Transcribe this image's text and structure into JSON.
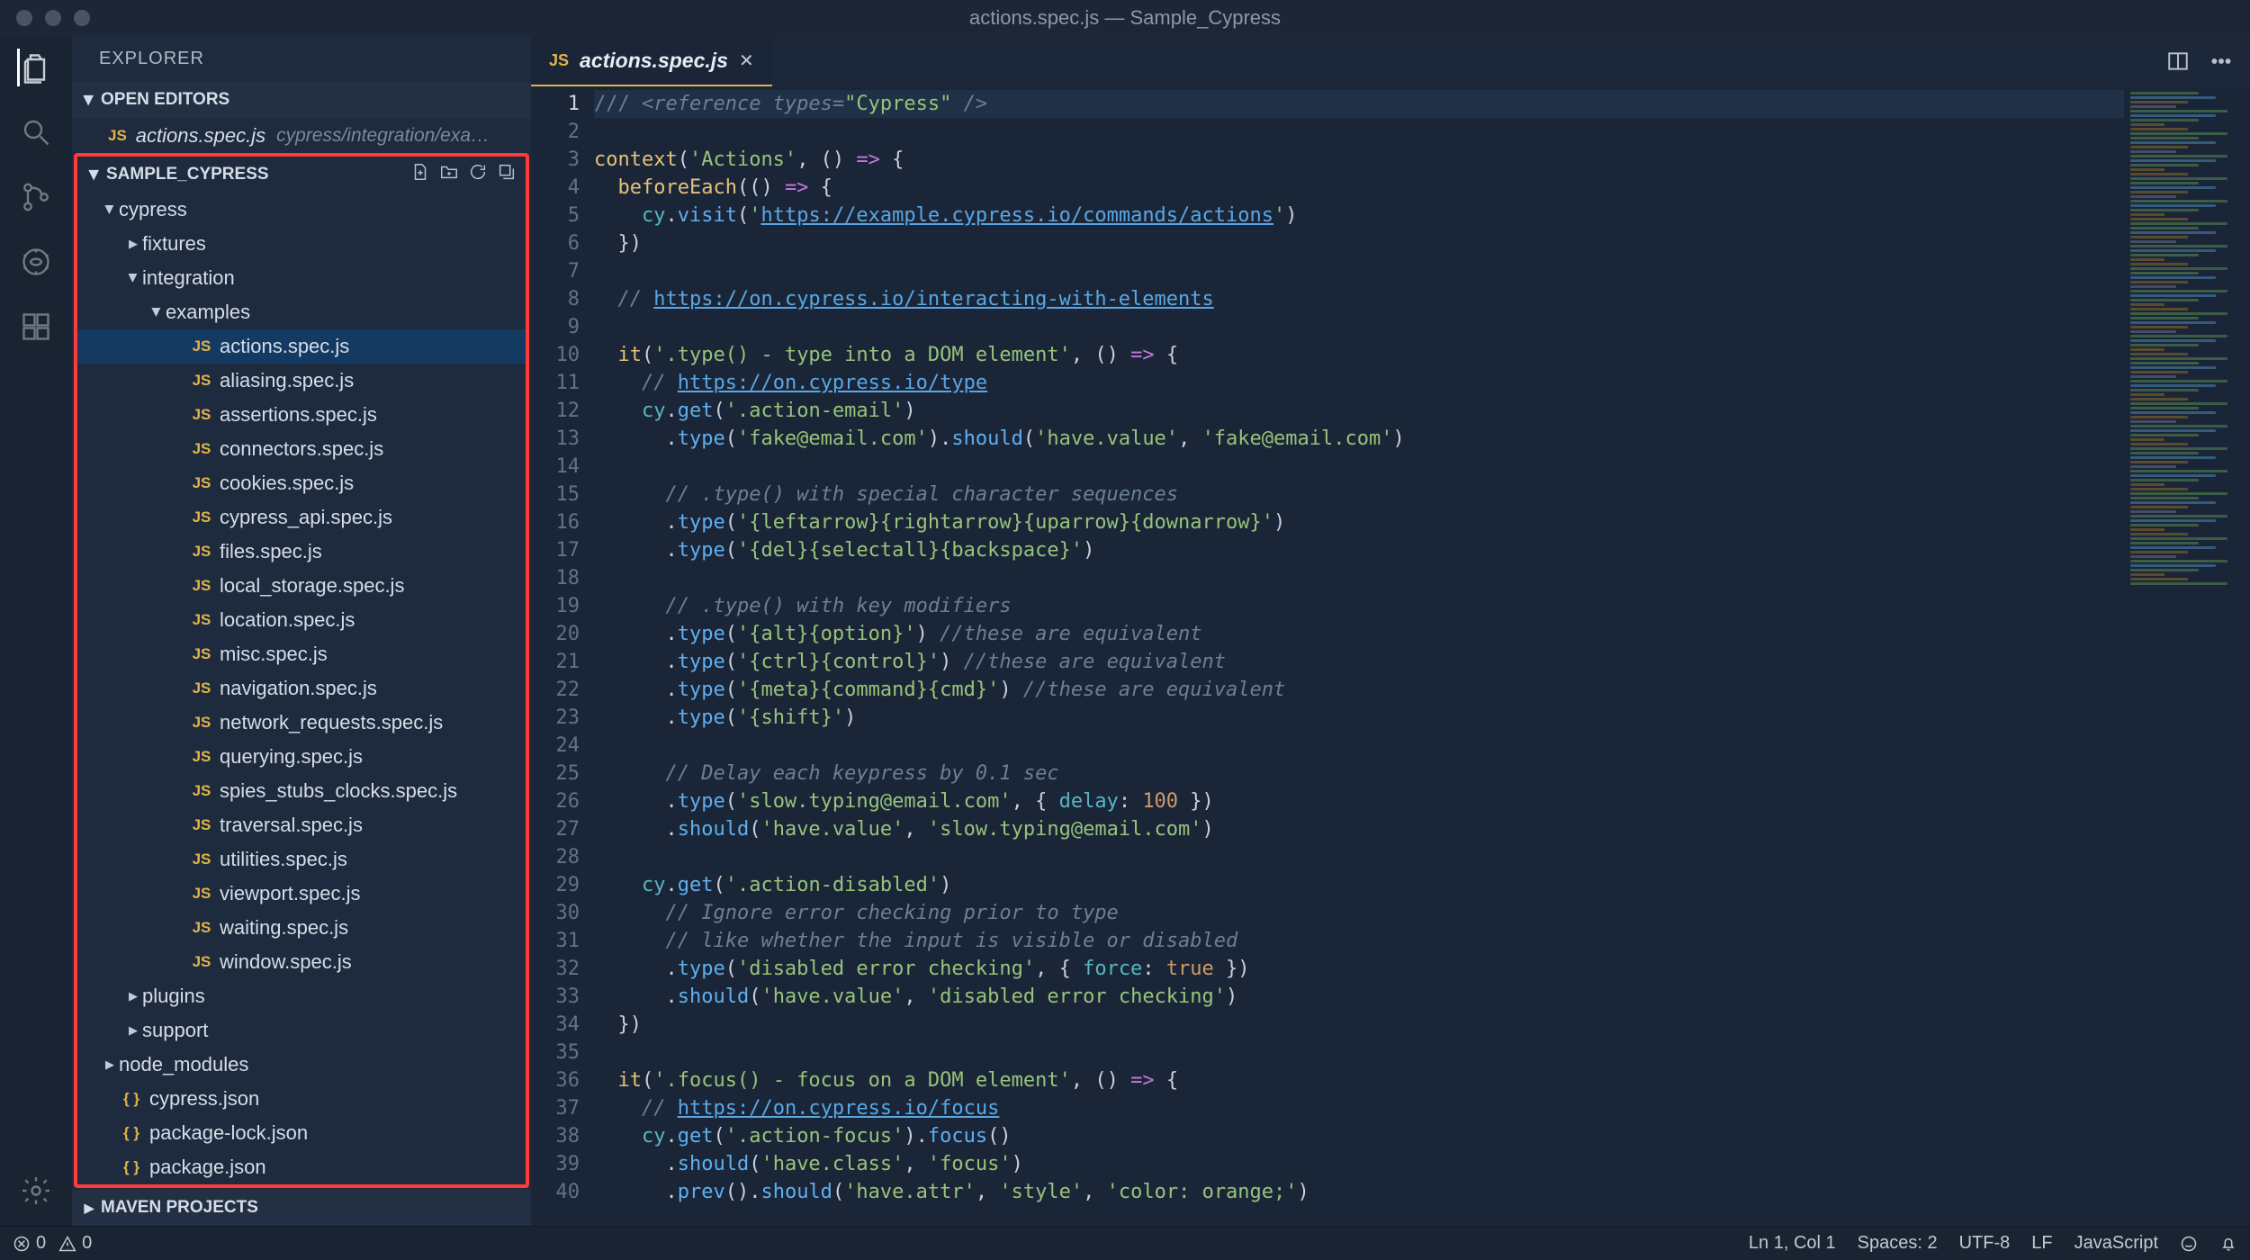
{
  "title": "actions.spec.js — Sample_Cypress",
  "sidebar": {
    "header": "EXPLORER",
    "sections": {
      "open_editors": {
        "label": "OPEN EDITORS",
        "items": [
          {
            "name": "actions.spec.js",
            "path": "cypress/integration/exa…",
            "icon": "JS"
          }
        ]
      },
      "project": {
        "label": "SAMPLE_CYPRESS",
        "tree": [
          {
            "label": "cypress",
            "type": "folder",
            "expanded": true,
            "depth": 0
          },
          {
            "label": "fixtures",
            "type": "folder",
            "expanded": false,
            "depth": 1
          },
          {
            "label": "integration",
            "type": "folder",
            "expanded": true,
            "depth": 1
          },
          {
            "label": "examples",
            "type": "folder",
            "expanded": true,
            "depth": 2
          },
          {
            "label": "actions.spec.js",
            "type": "js",
            "depth": 3,
            "selected": true
          },
          {
            "label": "aliasing.spec.js",
            "type": "js",
            "depth": 3
          },
          {
            "label": "assertions.spec.js",
            "type": "js",
            "depth": 3
          },
          {
            "label": "connectors.spec.js",
            "type": "js",
            "depth": 3
          },
          {
            "label": "cookies.spec.js",
            "type": "js",
            "depth": 3
          },
          {
            "label": "cypress_api.spec.js",
            "type": "js",
            "depth": 3
          },
          {
            "label": "files.spec.js",
            "type": "js",
            "depth": 3
          },
          {
            "label": "local_storage.spec.js",
            "type": "js",
            "depth": 3
          },
          {
            "label": "location.spec.js",
            "type": "js",
            "depth": 3
          },
          {
            "label": "misc.spec.js",
            "type": "js",
            "depth": 3
          },
          {
            "label": "navigation.spec.js",
            "type": "js",
            "depth": 3
          },
          {
            "label": "network_requests.spec.js",
            "type": "js",
            "depth": 3
          },
          {
            "label": "querying.spec.js",
            "type": "js",
            "depth": 3
          },
          {
            "label": "spies_stubs_clocks.spec.js",
            "type": "js",
            "depth": 3
          },
          {
            "label": "traversal.spec.js",
            "type": "js",
            "depth": 3
          },
          {
            "label": "utilities.spec.js",
            "type": "js",
            "depth": 3
          },
          {
            "label": "viewport.spec.js",
            "type": "js",
            "depth": 3
          },
          {
            "label": "waiting.spec.js",
            "type": "js",
            "depth": 3
          },
          {
            "label": "window.spec.js",
            "type": "js",
            "depth": 3
          },
          {
            "label": "plugins",
            "type": "folder",
            "expanded": false,
            "depth": 1
          },
          {
            "label": "support",
            "type": "folder",
            "expanded": false,
            "depth": 1
          },
          {
            "label": "node_modules",
            "type": "folder",
            "expanded": false,
            "depth": 0
          },
          {
            "label": "cypress.json",
            "type": "json",
            "depth": 0
          },
          {
            "label": "package-lock.json",
            "type": "json",
            "depth": 0
          },
          {
            "label": "package.json",
            "type": "json",
            "depth": 0
          }
        ]
      },
      "maven": {
        "label": "MAVEN PROJECTS"
      }
    }
  },
  "tabs": [
    {
      "name": "actions.spec.js",
      "icon": "JS",
      "active": true
    }
  ],
  "code": {
    "lines": [
      {
        "n": 1,
        "hl": true,
        "tokens": [
          [
            "c-comment",
            "/// "
          ],
          [
            "c-tag",
            "<reference "
          ],
          [
            "c-commentit",
            "types"
          ],
          [
            "c-tag",
            "="
          ],
          [
            "c-str",
            "\"Cypress\""
          ],
          [
            "c-tag",
            " />"
          ]
        ]
      },
      {
        "n": 2,
        "tokens": []
      },
      {
        "n": 3,
        "tokens": [
          [
            "c-fn",
            "context"
          ],
          [
            "c-plain",
            "("
          ],
          [
            "c-str",
            "'Actions'"
          ],
          [
            "c-plain",
            ", () "
          ],
          [
            "c-arrow",
            "=>"
          ],
          [
            "c-plain",
            " {"
          ]
        ]
      },
      {
        "n": 4,
        "tokens": [
          [
            "c-plain",
            "  "
          ],
          [
            "c-fn",
            "beforeEach"
          ],
          [
            "c-plain",
            "(() "
          ],
          [
            "c-arrow",
            "=>"
          ],
          [
            "c-plain",
            " {"
          ]
        ]
      },
      {
        "n": 5,
        "tokens": [
          [
            "c-plain",
            "    "
          ],
          [
            "c-this",
            "cy"
          ],
          [
            "c-plain",
            "."
          ],
          [
            "c-call",
            "visit"
          ],
          [
            "c-plain",
            "("
          ],
          [
            "c-str",
            "'"
          ],
          [
            "c-url",
            "https://example.cypress.io/commands/actions"
          ],
          [
            "c-str",
            "'"
          ],
          [
            "c-plain",
            ")"
          ]
        ]
      },
      {
        "n": 6,
        "tokens": [
          [
            "c-plain",
            "  })"
          ]
        ]
      },
      {
        "n": 7,
        "tokens": []
      },
      {
        "n": 8,
        "tokens": [
          [
            "c-plain",
            "  "
          ],
          [
            "c-commentit",
            "// "
          ],
          [
            "c-url",
            "https://on.cypress.io/interacting-with-elements"
          ]
        ]
      },
      {
        "n": 9,
        "tokens": []
      },
      {
        "n": 10,
        "tokens": [
          [
            "c-plain",
            "  "
          ],
          [
            "c-fn",
            "it"
          ],
          [
            "c-plain",
            "("
          ],
          [
            "c-str",
            "'.type() - type into a DOM element'"
          ],
          [
            "c-plain",
            ", () "
          ],
          [
            "c-arrow",
            "=>"
          ],
          [
            "c-plain",
            " {"
          ]
        ]
      },
      {
        "n": 11,
        "tokens": [
          [
            "c-plain",
            "    "
          ],
          [
            "c-commentit",
            "// "
          ],
          [
            "c-url",
            "https://on.cypress.io/type"
          ]
        ]
      },
      {
        "n": 12,
        "tokens": [
          [
            "c-plain",
            "    "
          ],
          [
            "c-this",
            "cy"
          ],
          [
            "c-plain",
            "."
          ],
          [
            "c-call",
            "get"
          ],
          [
            "c-plain",
            "("
          ],
          [
            "c-str",
            "'.action-email'"
          ],
          [
            "c-plain",
            ")"
          ]
        ]
      },
      {
        "n": 13,
        "tokens": [
          [
            "c-plain",
            "      ."
          ],
          [
            "c-call",
            "type"
          ],
          [
            "c-plain",
            "("
          ],
          [
            "c-str",
            "'fake@email.com'"
          ],
          [
            "c-plain",
            ")."
          ],
          [
            "c-call",
            "should"
          ],
          [
            "c-plain",
            "("
          ],
          [
            "c-str",
            "'have.value'"
          ],
          [
            "c-plain",
            ", "
          ],
          [
            "c-str",
            "'fake@email.com'"
          ],
          [
            "c-plain",
            ")"
          ]
        ]
      },
      {
        "n": 14,
        "tokens": []
      },
      {
        "n": 15,
        "tokens": [
          [
            "c-plain",
            "      "
          ],
          [
            "c-commentit",
            "// .type() with special character sequences"
          ]
        ]
      },
      {
        "n": 16,
        "tokens": [
          [
            "c-plain",
            "      ."
          ],
          [
            "c-call",
            "type"
          ],
          [
            "c-plain",
            "("
          ],
          [
            "c-str",
            "'{leftarrow}{rightarrow}{uparrow}{downarrow}'"
          ],
          [
            "c-plain",
            ")"
          ]
        ]
      },
      {
        "n": 17,
        "tokens": [
          [
            "c-plain",
            "      ."
          ],
          [
            "c-call",
            "type"
          ],
          [
            "c-plain",
            "("
          ],
          [
            "c-str",
            "'{del}{selectall}{backspace}'"
          ],
          [
            "c-plain",
            ")"
          ]
        ]
      },
      {
        "n": 18,
        "tokens": []
      },
      {
        "n": 19,
        "tokens": [
          [
            "c-plain",
            "      "
          ],
          [
            "c-commentit",
            "// .type() with key modifiers"
          ]
        ]
      },
      {
        "n": 20,
        "tokens": [
          [
            "c-plain",
            "      ."
          ],
          [
            "c-call",
            "type"
          ],
          [
            "c-plain",
            "("
          ],
          [
            "c-str",
            "'{alt}{option}'"
          ],
          [
            "c-plain",
            ") "
          ],
          [
            "c-commentit",
            "//these are equivalent"
          ]
        ]
      },
      {
        "n": 21,
        "tokens": [
          [
            "c-plain",
            "      ."
          ],
          [
            "c-call",
            "type"
          ],
          [
            "c-plain",
            "("
          ],
          [
            "c-str",
            "'{ctrl}{control}'"
          ],
          [
            "c-plain",
            ") "
          ],
          [
            "c-commentit",
            "//these are equivalent"
          ]
        ]
      },
      {
        "n": 22,
        "tokens": [
          [
            "c-plain",
            "      ."
          ],
          [
            "c-call",
            "type"
          ],
          [
            "c-plain",
            "("
          ],
          [
            "c-str",
            "'{meta}{command}{cmd}'"
          ],
          [
            "c-plain",
            ") "
          ],
          [
            "c-commentit",
            "//these are equivalent"
          ]
        ]
      },
      {
        "n": 23,
        "tokens": [
          [
            "c-plain",
            "      ."
          ],
          [
            "c-call",
            "type"
          ],
          [
            "c-plain",
            "("
          ],
          [
            "c-str",
            "'{shift}'"
          ],
          [
            "c-plain",
            ")"
          ]
        ]
      },
      {
        "n": 24,
        "tokens": []
      },
      {
        "n": 25,
        "tokens": [
          [
            "c-plain",
            "      "
          ],
          [
            "c-commentit",
            "// Delay each keypress by 0.1 sec"
          ]
        ]
      },
      {
        "n": 26,
        "tokens": [
          [
            "c-plain",
            "      ."
          ],
          [
            "c-call",
            "type"
          ],
          [
            "c-plain",
            "("
          ],
          [
            "c-str",
            "'slow.typing@email.com'"
          ],
          [
            "c-plain",
            ", { "
          ],
          [
            "c-prop",
            "delay"
          ],
          [
            "c-plain",
            ": "
          ],
          [
            "c-num",
            "100"
          ],
          [
            "c-plain",
            " })"
          ]
        ]
      },
      {
        "n": 27,
        "tokens": [
          [
            "c-plain",
            "      ."
          ],
          [
            "c-call",
            "should"
          ],
          [
            "c-plain",
            "("
          ],
          [
            "c-str",
            "'have.value'"
          ],
          [
            "c-plain",
            ", "
          ],
          [
            "c-str",
            "'slow.typing@email.com'"
          ],
          [
            "c-plain",
            ")"
          ]
        ]
      },
      {
        "n": 28,
        "tokens": []
      },
      {
        "n": 29,
        "tokens": [
          [
            "c-plain",
            "    "
          ],
          [
            "c-this",
            "cy"
          ],
          [
            "c-plain",
            "."
          ],
          [
            "c-call",
            "get"
          ],
          [
            "c-plain",
            "("
          ],
          [
            "c-str",
            "'.action-disabled'"
          ],
          [
            "c-plain",
            ")"
          ]
        ]
      },
      {
        "n": 30,
        "tokens": [
          [
            "c-plain",
            "      "
          ],
          [
            "c-commentit",
            "// Ignore error checking prior to type"
          ]
        ]
      },
      {
        "n": 31,
        "tokens": [
          [
            "c-plain",
            "      "
          ],
          [
            "c-commentit",
            "// like whether the input is visible or disabled"
          ]
        ]
      },
      {
        "n": 32,
        "tokens": [
          [
            "c-plain",
            "      ."
          ],
          [
            "c-call",
            "type"
          ],
          [
            "c-plain",
            "("
          ],
          [
            "c-str",
            "'disabled error checking'"
          ],
          [
            "c-plain",
            ", { "
          ],
          [
            "c-prop",
            "force"
          ],
          [
            "c-plain",
            ": "
          ],
          [
            "c-bool",
            "true"
          ],
          [
            "c-plain",
            " })"
          ]
        ]
      },
      {
        "n": 33,
        "tokens": [
          [
            "c-plain",
            "      ."
          ],
          [
            "c-call",
            "should"
          ],
          [
            "c-plain",
            "("
          ],
          [
            "c-str",
            "'have.value'"
          ],
          [
            "c-plain",
            ", "
          ],
          [
            "c-str",
            "'disabled error checking'"
          ],
          [
            "c-plain",
            ")"
          ]
        ]
      },
      {
        "n": 34,
        "tokens": [
          [
            "c-plain",
            "  })"
          ]
        ]
      },
      {
        "n": 35,
        "tokens": []
      },
      {
        "n": 36,
        "tokens": [
          [
            "c-plain",
            "  "
          ],
          [
            "c-fn",
            "it"
          ],
          [
            "c-plain",
            "("
          ],
          [
            "c-str",
            "'.focus() - focus on a DOM element'"
          ],
          [
            "c-plain",
            ", () "
          ],
          [
            "c-arrow",
            "=>"
          ],
          [
            "c-plain",
            " {"
          ]
        ]
      },
      {
        "n": 37,
        "tokens": [
          [
            "c-plain",
            "    "
          ],
          [
            "c-commentit",
            "// "
          ],
          [
            "c-url",
            "https://on.cypress.io/focus"
          ]
        ]
      },
      {
        "n": 38,
        "tokens": [
          [
            "c-plain",
            "    "
          ],
          [
            "c-this",
            "cy"
          ],
          [
            "c-plain",
            "."
          ],
          [
            "c-call",
            "get"
          ],
          [
            "c-plain",
            "("
          ],
          [
            "c-str",
            "'.action-focus'"
          ],
          [
            "c-plain",
            ")."
          ],
          [
            "c-call",
            "focus"
          ],
          [
            "c-plain",
            "()"
          ]
        ]
      },
      {
        "n": 39,
        "tokens": [
          [
            "c-plain",
            "      ."
          ],
          [
            "c-call",
            "should"
          ],
          [
            "c-plain",
            "("
          ],
          [
            "c-str",
            "'have.class'"
          ],
          [
            "c-plain",
            ", "
          ],
          [
            "c-str",
            "'focus'"
          ],
          [
            "c-plain",
            ")"
          ]
        ]
      },
      {
        "n": 40,
        "tokens": [
          [
            "c-plain",
            "      ."
          ],
          [
            "c-call",
            "prev"
          ],
          [
            "c-plain",
            "()."
          ],
          [
            "c-call",
            "should"
          ],
          [
            "c-plain",
            "("
          ],
          [
            "c-str",
            "'have.attr'"
          ],
          [
            "c-plain",
            ", "
          ],
          [
            "c-str",
            "'style'"
          ],
          [
            "c-plain",
            ", "
          ],
          [
            "c-str",
            "'color: orange;'"
          ],
          [
            "c-plain",
            ")"
          ]
        ]
      }
    ]
  },
  "statusbar": {
    "errors": "0",
    "warnings": "0",
    "cursor": "Ln 1, Col 1",
    "spaces": "Spaces: 2",
    "encoding": "UTF-8",
    "eol": "LF",
    "language": "JavaScript"
  }
}
